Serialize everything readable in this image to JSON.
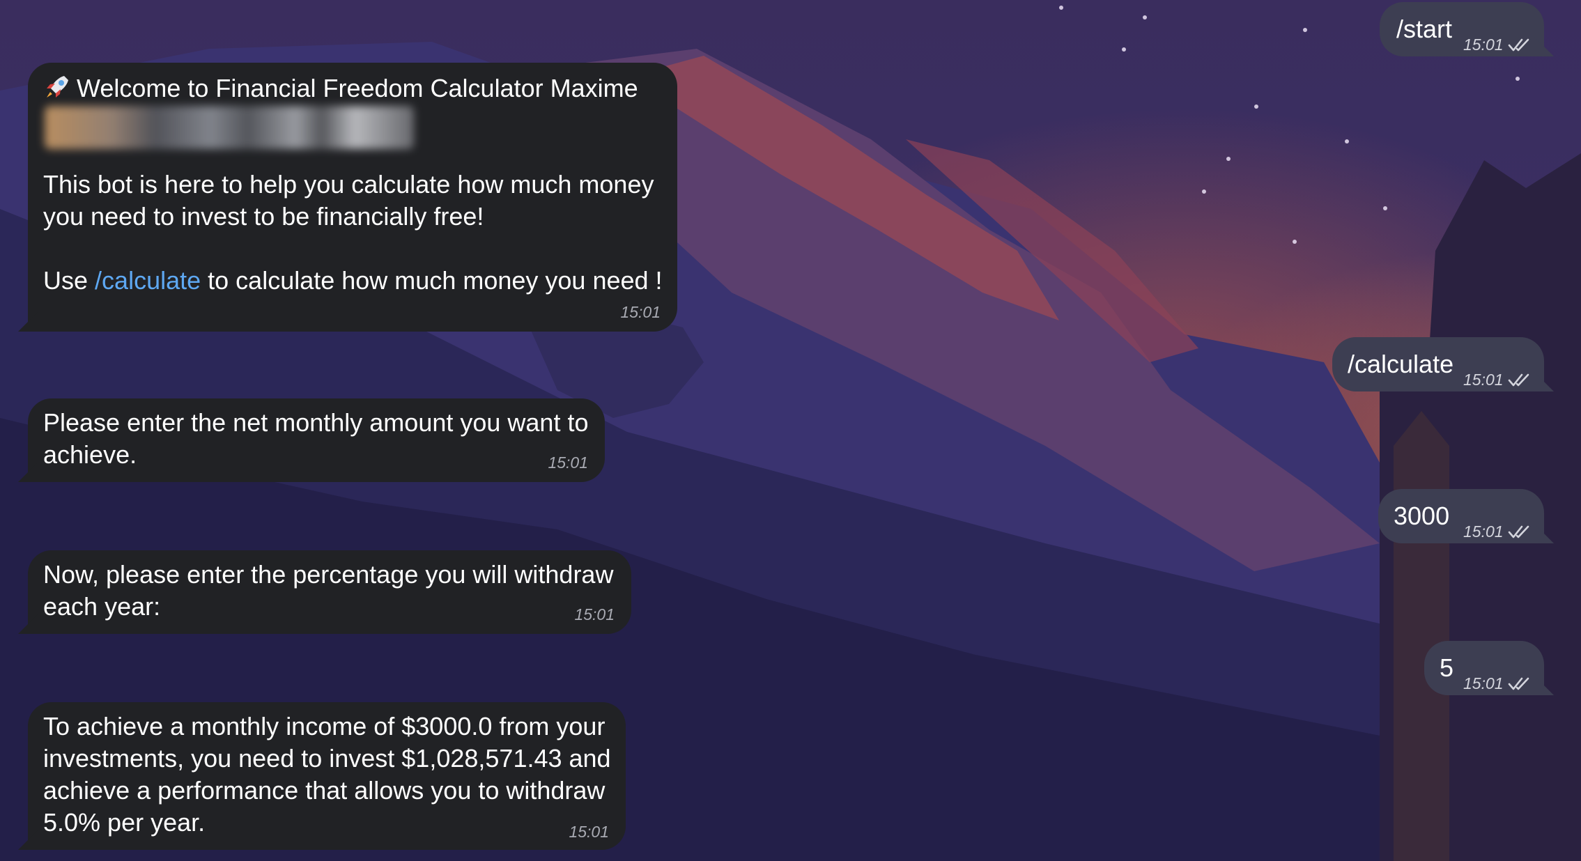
{
  "chat": {
    "incoming": [
      {
        "title": "Welcome to Financial Freedom Calculator Maxime",
        "paragraph1": "This bot is here to help you calculate how much money you need to invest to be financially free!",
        "use_prefix": "Use",
        "command": "/calculate",
        "use_suffix": "to calculate how much money you need !",
        "time": "15:01"
      },
      {
        "text": "Please enter the net monthly amount you want to achieve.",
        "time": "15:01"
      },
      {
        "text": "Now, please enter the percentage you will withdraw each year:",
        "time": "15:01"
      },
      {
        "text": "To achieve a monthly income of $3000.0 from your investments, you need to invest $1,028,571.43 and achieve a performance that allows you to withdraw 5.0% per year.",
        "time": "15:01"
      }
    ],
    "outgoing": [
      {
        "text": "/start",
        "time": "15:01"
      },
      {
        "text": "/calculate",
        "time": "15:01"
      },
      {
        "text": "3000",
        "time": "15:01"
      },
      {
        "text": "5",
        "time": "15:01"
      }
    ]
  },
  "icons": {
    "rocket": "rocket-emoji-icon",
    "read_receipt": "double-check-icon"
  },
  "colors": {
    "incoming_bubble": "#212225",
    "outgoing_bubble": "#3d3e52",
    "link": "#5ea8f2",
    "timestamp": "#a9abb3"
  }
}
